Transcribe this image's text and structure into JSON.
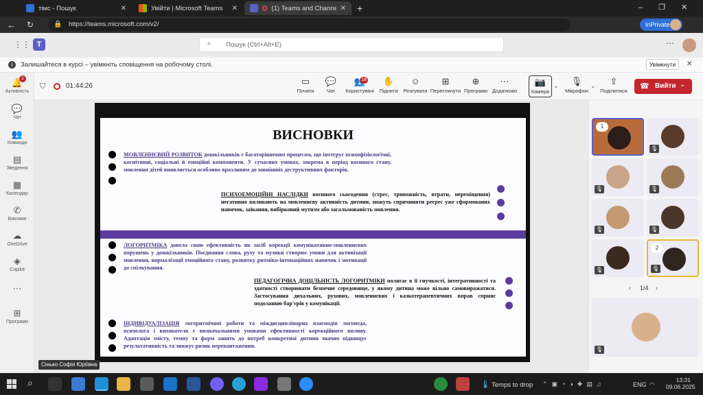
{
  "tabs": [
    {
      "title": "тімс - Пошук"
    },
    {
      "title": "Увійти | Microsoft Teams"
    },
    {
      "title": "(1) Teams and Channels | Зас"
    }
  ],
  "browser": {
    "url": "https://teams.microsoft.com/v2/",
    "inprivate": "InPrivate"
  },
  "teams": {
    "search_placeholder": "Пошук (Ctrl+Alt+E)"
  },
  "banner": {
    "text": "Залишайтеся в курсі – увімкніть сповіщення на робочому столі.",
    "button": "Увімкнути"
  },
  "rail": [
    {
      "label": "Активність",
      "icon": "bell-icon",
      "badge": "1"
    },
    {
      "label": "Чат",
      "icon": "chat-icon"
    },
    {
      "label": "Команди",
      "icon": "teams-icon"
    },
    {
      "label": "Зведення",
      "icon": "summary-icon"
    },
    {
      "label": "Календар",
      "icon": "calendar-icon"
    },
    {
      "label": "Виклики",
      "icon": "phone-icon"
    },
    {
      "label": "OneDrive",
      "icon": "onedrive-icon"
    },
    {
      "label": "Copilot",
      "icon": "copilot-icon"
    },
    {
      "label": "Програми",
      "icon": "apps-icon"
    }
  ],
  "call": {
    "timer": "01:44:26",
    "controls": [
      {
        "label": "Почати",
        "icon": "whiteboard-icon"
      },
      {
        "label": "Чат",
        "icon": "chat-icon"
      },
      {
        "label": "Користувачі",
        "icon": "people-icon",
        "badge": "18"
      },
      {
        "label": "Підняти",
        "icon": "hand-icon"
      },
      {
        "label": "Реагувати",
        "icon": "smile-icon"
      },
      {
        "label": "Переглянути",
        "icon": "grid-icon"
      },
      {
        "label": "Програми",
        "icon": "plus-icon"
      },
      {
        "label": "Додатково",
        "icon": "more-icon"
      },
      {
        "label": "Камера",
        "icon": "camera-off-icon"
      },
      {
        "label": "Мікрофон",
        "icon": "mic-off-icon"
      },
      {
        "label": "Поділитися",
        "icon": "share-icon"
      }
    ],
    "leave": "Вийти",
    "presenter_name": "Сінько Софія Юріївна",
    "pager": "1/4"
  },
  "slide": {
    "title": "ВИСНОВКИ",
    "p1_head": "МОВЛЕННЄВИЙ РОЗВИТОК",
    "p1": " дошкільників є багаторівневим процесом, що інтегрує психофізіологічні, когнітивні, соціальні й емоційні компоненти. У сучасних умовах, зокрема в період воєнного стану, мовлення дітей виявляється особливо вразливим до зовнішніх деструктивних факторів.",
    "p2_head": "ПСИХОЕМОЦІЙНІ НАСЛІДКИ",
    "p2": " воєнного сьогодення (стрес, тривожність, втрати, переміщення) негативно впливають на мовленнєву активність дитини, можуть спричиняти регрес уже сформованих навичок, заїкання, вибірковий мутизм або загальмованість мовлення.",
    "p3_head": "ЛОГОРИТМІКА",
    "p3": " довела свою ефективність як засіб корекції комунікативно-мовленнєвих порушень у дошкільників. Поєднання слова, руху та музики створює умови для активізації мовлення, нормалізації емоційного стану, розвитку ритміко-інтонаційних навичок і мотивації до спілкування.",
    "p4_head": "ПЕДАГОГІЧНА ДОЦІЛЬНІСТЬ ЛОГОРИТМІКИ",
    "p4": " полягає в її гнучкості, інтегративності та здатності створювати безпечне середовище, у якому дитина може вільно самовиражатися. Застосування дихальних, рухових, мовленнєвих і казкотерапевтичних вправ сприяє подоланню бар'єрів у комунікації.",
    "p5_head": "ІНДИВІДУАЛІЗАЦІЯ",
    "p5": " логоритмічної роботи та міждисциплінарна взаємодія логопеда, психолога і вихователя є визначальними умовами ефективності корекційного впливу. Адаптація змісту, темпу та форм занять до потреб конкретної дитини значно підвищує результативність та знижує ризик перевантаження."
  },
  "participants": {
    "tile1_badge": "1",
    "tile9_badge": "2"
  },
  "taskbar": {
    "weather": "Temps to drop",
    "lang": "ENG",
    "time": "13:31",
    "date": "09.06.2025"
  },
  "colors": {
    "accent": "#5a3d9e",
    "leave": "#c4262e",
    "teams": "#5b5fc7"
  }
}
